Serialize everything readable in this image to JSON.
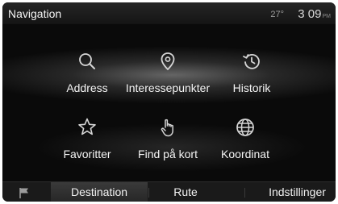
{
  "header": {
    "title": "Navigation",
    "temperature": "27°",
    "time": "3 09",
    "ampm": "PM"
  },
  "menu": {
    "items": [
      {
        "label": "Address",
        "icon": "search-icon"
      },
      {
        "label": "Interessepunkter",
        "icon": "location-pin-icon"
      },
      {
        "label": "Historik",
        "icon": "history-icon"
      },
      {
        "label": "Favoritter",
        "icon": "star-icon"
      },
      {
        "label": "Find på kort",
        "icon": "hand-pointer-icon"
      },
      {
        "label": "Koordinat",
        "icon": "globe-icon"
      }
    ]
  },
  "bottom_bar": {
    "flag_icon": "flag-icon",
    "tabs": [
      {
        "label": "Destination",
        "active": true
      },
      {
        "label": "Rute",
        "active": false
      },
      {
        "label": "Indstillinger",
        "active": false
      }
    ]
  }
}
